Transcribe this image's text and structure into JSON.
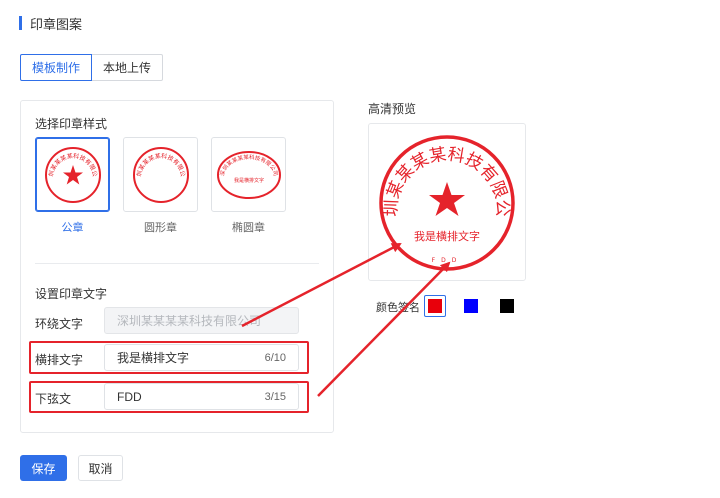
{
  "header": {
    "title": "印章图案"
  },
  "tabs": [
    {
      "label": "模板制作",
      "active": true
    },
    {
      "label": "本地上传",
      "active": false
    }
  ],
  "template_section": {
    "title": "选择印章样式",
    "items": [
      {
        "label": "公章",
        "active": true,
        "shape": "round-star",
        "seal_text": "深圳某某某某科技有限公司"
      },
      {
        "label": "圆形章",
        "active": false,
        "shape": "round",
        "seal_text": "深圳某某某某科技有限公司"
      },
      {
        "label": "椭圆章",
        "active": false,
        "shape": "oval",
        "seal_text": "深圳某某某某科技有限公司",
        "inner_text": "我是横排文字"
      }
    ]
  },
  "text_section": {
    "title": "设置印章文字",
    "ring_label": "环绕文字",
    "ring_value": "深圳某某某某科技有限公司",
    "horizontal_label": "横排文字",
    "horizontal_value": "我是横排文字",
    "horizontal_count": "6/10",
    "bottom_label": "下弦文",
    "bottom_value": "FDD",
    "bottom_count": "3/15"
  },
  "preview": {
    "title": "高清预览",
    "ring_text": "深圳某某某某科技有限公司",
    "center_text": "我是横排文字",
    "bottom_text": "FDD"
  },
  "color": {
    "label": "颜色签名",
    "options": [
      {
        "name": "red",
        "hex": "#e8000b",
        "active": true
      },
      {
        "name": "blue",
        "hex": "#0000ff",
        "active": false
      },
      {
        "name": "black",
        "hex": "#000000",
        "active": false
      }
    ]
  },
  "accent_color": "#2f6fe8",
  "seal_color": "#e5232b",
  "buttons": {
    "save": "保存",
    "cancel": "取消"
  }
}
